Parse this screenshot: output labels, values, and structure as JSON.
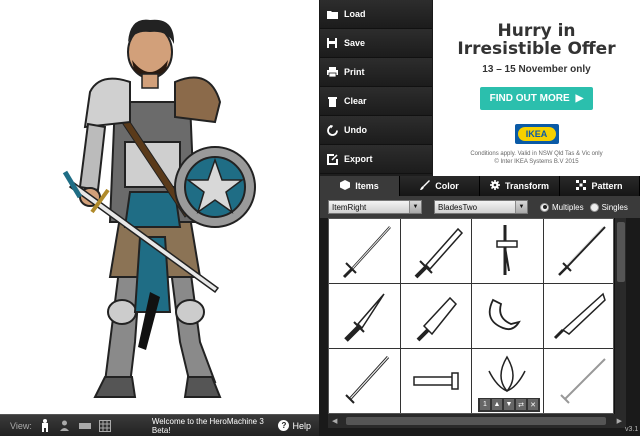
{
  "menu": {
    "items": [
      {
        "label": "Load",
        "icon": "folder-icon"
      },
      {
        "label": "Save",
        "icon": "floppy-icon"
      },
      {
        "label": "Print",
        "icon": "printer-icon"
      },
      {
        "label": "Clear",
        "icon": "trash-icon"
      },
      {
        "label": "Undo",
        "icon": "undo-icon"
      },
      {
        "label": "Export",
        "icon": "export-icon"
      }
    ]
  },
  "ad": {
    "title_line1": "Hurry in",
    "title_line2": "Irresistible Offer",
    "dates": "13 – 15 November only",
    "button": "FIND OUT MORE",
    "brand": "IKEA",
    "fine1": "Conditions apply. Valid in NSW Qld Tas & Vic only",
    "fine2": "© Inter IKEA Systems B.V 2015",
    "accent": "#2bbfad"
  },
  "tabs": [
    {
      "label": "Items",
      "icon": "cube-icon",
      "active": true
    },
    {
      "label": "Color",
      "icon": "brush-icon",
      "active": false
    },
    {
      "label": "Transform",
      "icon": "gear-icon",
      "active": false
    },
    {
      "label": "Pattern",
      "icon": "grid-icon",
      "active": false
    }
  ],
  "selectors": {
    "slot": "ItemRight",
    "category": "BladesTwo",
    "mode_multiples": "Multiples",
    "mode_singles": "Singles"
  },
  "statusbar": {
    "view_label": "View:",
    "welcome": "Welcome to the HeroMachine 3 Beta!",
    "help": "Help"
  },
  "version": "v3.1"
}
